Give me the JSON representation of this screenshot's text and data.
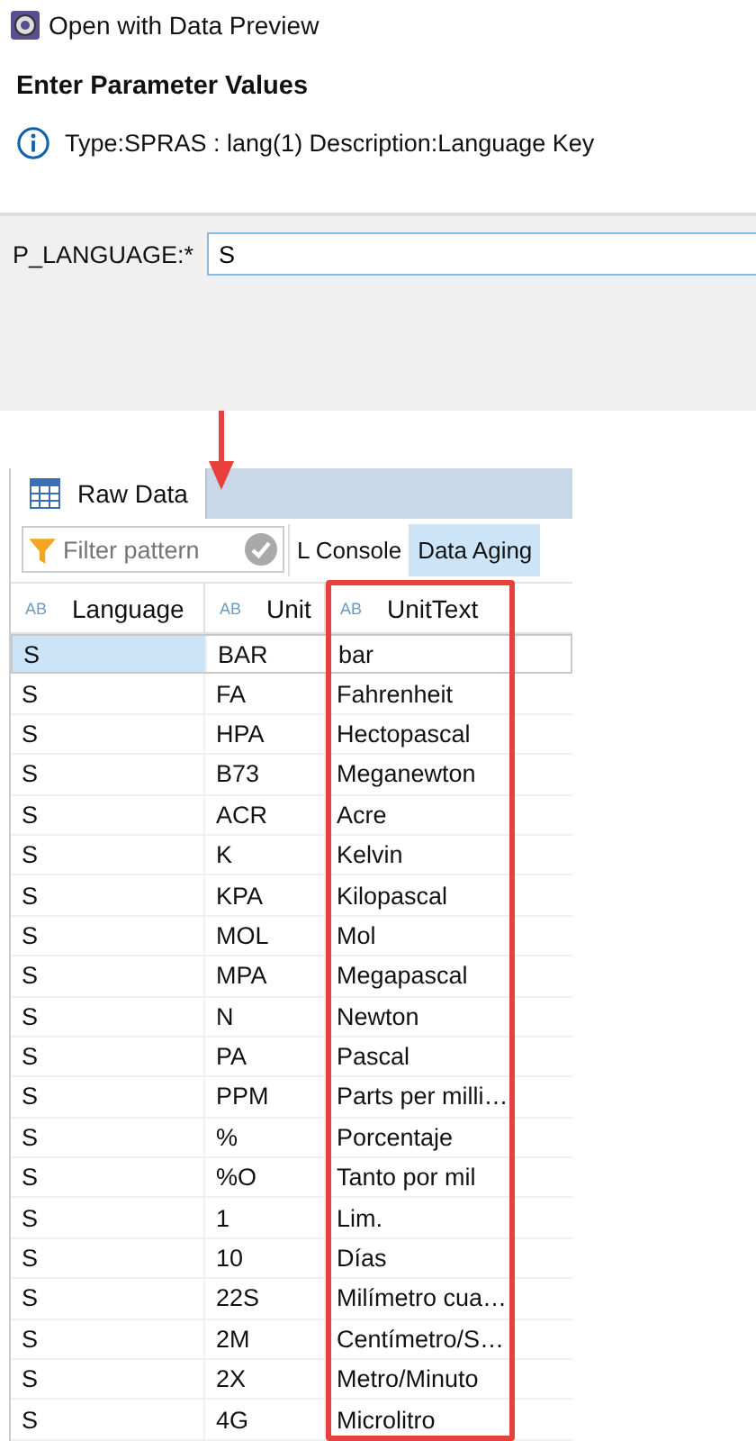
{
  "dialog": {
    "title": "Open with Data Preview",
    "heading": "Enter Parameter Values",
    "info": "Type:SPRAS : lang(1) Description:Language Key"
  },
  "parameter": {
    "label": "P_LANGUAGE:*",
    "value": "S"
  },
  "annotation_arrow": true,
  "tabs": [
    {
      "label": "Raw Data",
      "selected": true
    }
  ],
  "toolbar": {
    "filter_placeholder": "Filter pattern",
    "buttons": [
      {
        "label": "L Console",
        "selected": false
      },
      {
        "label": "Data Aging",
        "selected": true
      }
    ]
  },
  "table": {
    "columns": [
      {
        "label": "Language",
        "type_badge": "AB",
        "highlighted": false
      },
      {
        "label": "Unit",
        "type_badge": "AB",
        "highlighted": false
      },
      {
        "label": "UnitText",
        "type_badge": "AB",
        "highlighted": true
      }
    ],
    "rows": [
      {
        "cells": [
          "S",
          "BAR",
          "bar"
        ],
        "selected": true
      },
      {
        "cells": [
          "S",
          "FA",
          "Fahrenheit"
        ],
        "selected": false
      },
      {
        "cells": [
          "S",
          "HPA",
          "Hectopascal"
        ],
        "selected": false
      },
      {
        "cells": [
          "S",
          "B73",
          "Meganewton"
        ],
        "selected": false
      },
      {
        "cells": [
          "S",
          "ACR",
          "Acre"
        ],
        "selected": false
      },
      {
        "cells": [
          "S",
          "K",
          "Kelvin"
        ],
        "selected": false
      },
      {
        "cells": [
          "S",
          "KPA",
          "Kilopascal"
        ],
        "selected": false
      },
      {
        "cells": [
          "S",
          "MOL",
          "Mol"
        ],
        "selected": false
      },
      {
        "cells": [
          "S",
          "MPA",
          "Megapascal"
        ],
        "selected": false
      },
      {
        "cells": [
          "S",
          "N",
          "Newton"
        ],
        "selected": false
      },
      {
        "cells": [
          "S",
          "PA",
          "Pascal"
        ],
        "selected": false
      },
      {
        "cells": [
          "S",
          "PPM",
          "Parts per milli…"
        ],
        "selected": false
      },
      {
        "cells": [
          "S",
          "%",
          "Porcentaje"
        ],
        "selected": false
      },
      {
        "cells": [
          "S",
          "%O",
          "Tanto por mil"
        ],
        "selected": false
      },
      {
        "cells": [
          "S",
          "1",
          "Lim."
        ],
        "selected": false
      },
      {
        "cells": [
          "S",
          "10",
          "Días"
        ],
        "selected": false
      },
      {
        "cells": [
          "S",
          "22S",
          "Milímetro cua…"
        ],
        "selected": false
      },
      {
        "cells": [
          "S",
          "2M",
          "Centímetro/S…"
        ],
        "selected": false
      },
      {
        "cells": [
          "S",
          "2X",
          "Metro/Minuto"
        ],
        "selected": false
      },
      {
        "cells": [
          "S",
          "4G",
          "Microlitro"
        ],
        "selected": false
      }
    ]
  }
}
